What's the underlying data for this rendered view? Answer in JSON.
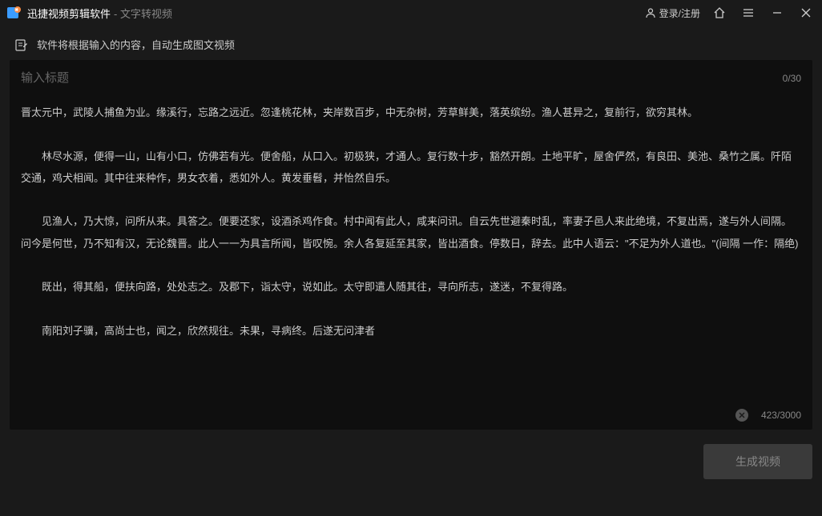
{
  "titlebar": {
    "app_name": "迅捷视频剪辑软件",
    "subtitle": "- 文字转视频",
    "login_label": "登录/注册"
  },
  "info": {
    "text": "软件将根据输入的内容，自动生成图文视频"
  },
  "editor": {
    "title_placeholder": "输入标题",
    "title_value": "",
    "title_counter": "0/30",
    "body_text": "晋太元中，武陵人捕鱼为业。缘溪行，忘路之远近。忽逢桃花林，夹岸数百步，中无杂树，芳草鲜美，落英缤纷。渔人甚异之，复前行，欲穷其林。\n\n　　林尽水源，便得一山，山有小口，仿佛若有光。便舍船，从口入。初极狭，才通人。复行数十步，豁然开朗。土地平旷，屋舍俨然，有良田、美池、桑竹之属。阡陌交通，鸡犬相闻。其中往来种作，男女衣着，悉如外人。黄发垂髫，并怡然自乐。\n\n　　见渔人，乃大惊，问所从来。具答之。便要还家，设酒杀鸡作食。村中闻有此人，咸来问讯。自云先世避秦时乱，率妻子邑人来此绝境，不复出焉，遂与外人间隔。问今是何世，乃不知有汉，无论魏晋。此人一一为具言所闻，皆叹惋。余人各复延至其家，皆出酒食。停数日，辞去。此中人语云：\"不足为外人道也。\"(间隔 一作：隔绝)\n\n　　既出，得其船，便扶向路，处处志之。及郡下，诣太守，说如此。太守即遣人随其往，寻向所志，遂迷，不复得路。\n\n　　南阳刘子骥，高尚士也，闻之，欣然规往。未果，寻病终。后遂无问津者",
    "body_counter": "423/3000"
  },
  "actions": {
    "generate_label": "生成视频"
  }
}
